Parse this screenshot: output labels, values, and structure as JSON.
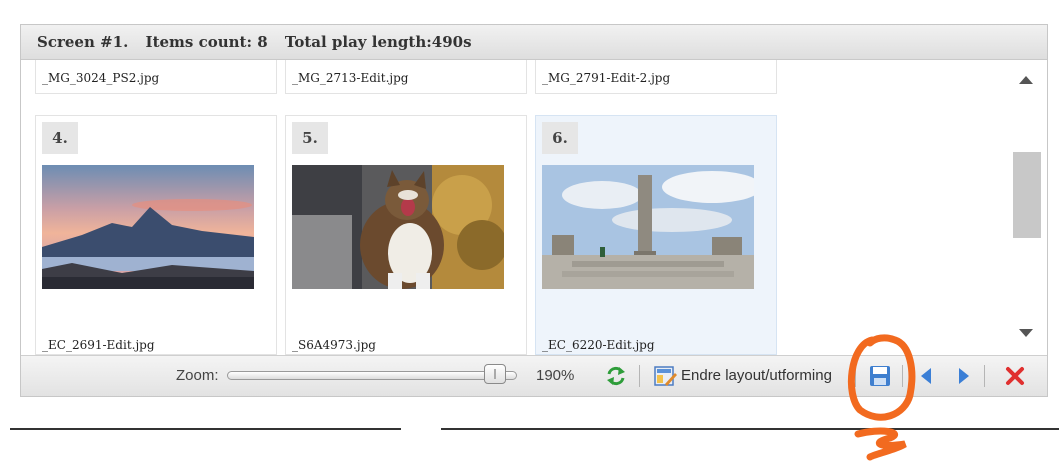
{
  "header": {
    "screen": "Screen #1.",
    "items_count": "Items count: 8",
    "play_length": "Total play length:490s"
  },
  "tiles_top": [
    {
      "filename": "_MG_3024_PS2.jpg"
    },
    {
      "filename": "_MG_2713-Edit.jpg"
    },
    {
      "filename": "_MG_2791-Edit-2.jpg"
    }
  ],
  "tiles": [
    {
      "number": "4.",
      "filename": "_EC_2691-Edit.jpg",
      "image": "mountain-sunset-photo"
    },
    {
      "number": "5.",
      "filename": "_S6A4973.jpg",
      "image": "cat-photo"
    },
    {
      "number": "6.",
      "filename": "_EC_6220-Edit.jpg",
      "image": "monolith-park-photo",
      "selected": true
    }
  ],
  "toolbar": {
    "zoom_label": "Zoom:",
    "zoom_value": "190%",
    "zoom_level_fraction": 0.93,
    "layout_label": "Endre layout/utforming"
  },
  "colors": {
    "annotation": "#f26a1f",
    "arrow_blue": "#3b7fd6",
    "close_red": "#e0302f",
    "refresh_green": "#2e9d3a"
  }
}
